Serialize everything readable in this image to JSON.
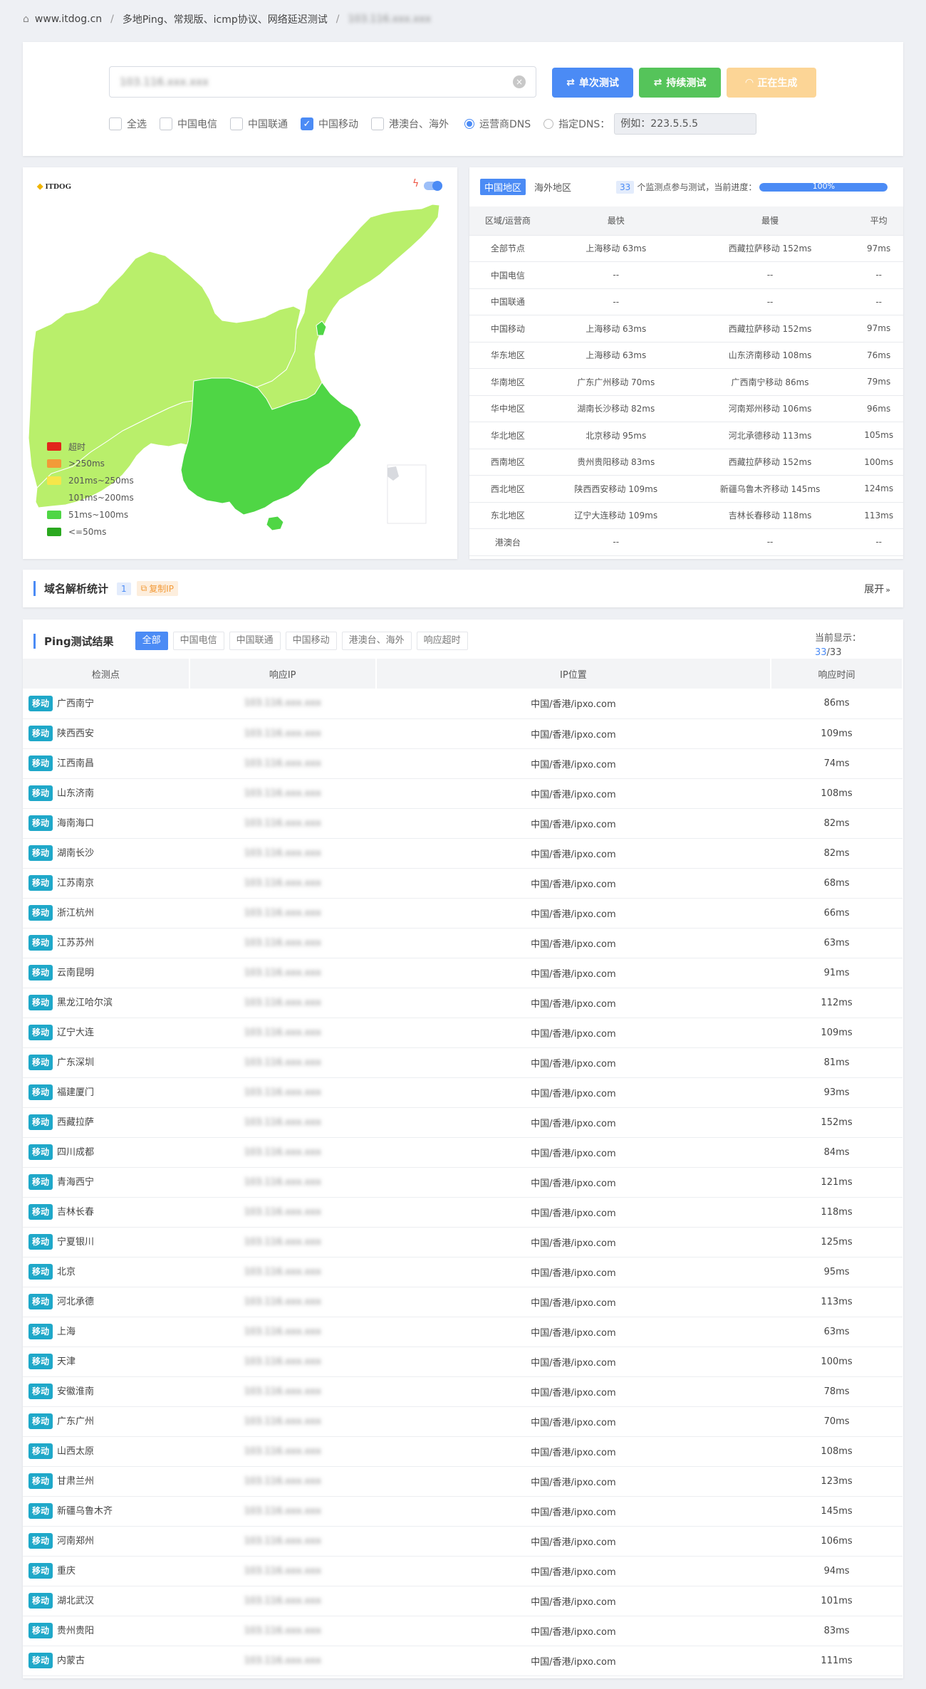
{
  "breadcrumb": {
    "home": "www.itdog.cn",
    "section": "多地Ping、常规版、icmp协议、网络延迟测试",
    "current": "103.116.xxx.xxx"
  },
  "search": {
    "value": "103.116.xxx.xxx",
    "clear": "×"
  },
  "buttons": {
    "single": "单次测试",
    "continuous": "持续测试",
    "generating": "正在生成"
  },
  "isp_options": [
    {
      "label": "全选",
      "checked": false
    },
    {
      "label": "中国电信",
      "checked": false
    },
    {
      "label": "中国联通",
      "checked": false
    },
    {
      "label": "中国移动",
      "checked": true
    },
    {
      "label": "港澳台、海外",
      "checked": false
    }
  ],
  "dns": {
    "operator": "运营商DNS",
    "custom": "指定DNS：",
    "placeholder": "例如：223.5.5.5"
  },
  "map": {
    "logo": "ITDOG",
    "legend": [
      {
        "label": "超时",
        "color": "#e1251b"
      },
      {
        "label": ">250ms",
        "color": "#f29a38"
      },
      {
        "label": "201ms~250ms",
        "color": "#f5e64a"
      },
      {
        "label": "101ms~200ms",
        "color": "#b9ef6b"
      },
      {
        "label": "51ms~100ms",
        "color": "#4fd645"
      },
      {
        "label": "<=50ms",
        "color": "#2aa81f"
      }
    ]
  },
  "stats": {
    "tab_cn": "中国地区",
    "tab_overseas": "海外地区",
    "count": "33",
    "count_text": "个监测点参与测试，当前进度：",
    "progress": 100,
    "progress_label": "100%",
    "headers": [
      "区域/运营商",
      "最快",
      "最慢",
      "平均"
    ],
    "rows": [
      [
        "全部节点",
        "上海移动 63ms",
        "西藏拉萨移动 152ms",
        "97ms"
      ],
      [
        "中国电信",
        "--",
        "--",
        "--"
      ],
      [
        "中国联通",
        "--",
        "--",
        "--"
      ],
      [
        "中国移动",
        "上海移动 63ms",
        "西藏拉萨移动 152ms",
        "97ms"
      ],
      [
        "华东地区",
        "上海移动 63ms",
        "山东济南移动 108ms",
        "76ms"
      ],
      [
        "华南地区",
        "广东广州移动 70ms",
        "广西南宁移动 86ms",
        "79ms"
      ],
      [
        "华中地区",
        "湖南长沙移动 82ms",
        "河南郑州移动 106ms",
        "96ms"
      ],
      [
        "华北地区",
        "北京移动 95ms",
        "河北承德移动 113ms",
        "105ms"
      ],
      [
        "西南地区",
        "贵州贵阳移动 83ms",
        "西藏拉萨移动 152ms",
        "100ms"
      ],
      [
        "西北地区",
        "陕西西安移动 109ms",
        "新疆乌鲁木齐移动 145ms",
        "124ms"
      ],
      [
        "东北地区",
        "辽宁大连移动 109ms",
        "吉林长春移动 118ms",
        "113ms"
      ],
      [
        "港澳台",
        "--",
        "--",
        "--"
      ]
    ]
  },
  "dns_stats": {
    "title": "域名解析统计",
    "count": "1",
    "copy": "复制IP",
    "expand": "展开"
  },
  "results": {
    "title": "Ping测试结果",
    "filters": [
      "全部",
      "中国电信",
      "中国联通",
      "中国移动",
      "港澳台、海外",
      "响应超时"
    ],
    "showing_label": "当前显示：",
    "showing": "33",
    "total": "/33",
    "headers": [
      "检测点",
      "响应IP",
      "IP位置",
      "响应时间"
    ],
    "tag": "移动",
    "ip": "103.116.xxx.xxx",
    "location": "中国/香港/ipxo.com",
    "rows": [
      [
        "广西南宁",
        "86ms"
      ],
      [
        "陕西西安",
        "109ms"
      ],
      [
        "江西南昌",
        "74ms"
      ],
      [
        "山东济南",
        "108ms"
      ],
      [
        "海南海口",
        "82ms"
      ],
      [
        "湖南长沙",
        "82ms"
      ],
      [
        "江苏南京",
        "68ms"
      ],
      [
        "浙江杭州",
        "66ms"
      ],
      [
        "江苏苏州",
        "63ms"
      ],
      [
        "云南昆明",
        "91ms"
      ],
      [
        "黑龙江哈尔滨",
        "112ms"
      ],
      [
        "辽宁大连",
        "109ms"
      ],
      [
        "广东深圳",
        "81ms"
      ],
      [
        "福建厦门",
        "93ms"
      ],
      [
        "西藏拉萨",
        "152ms"
      ],
      [
        "四川成都",
        "84ms"
      ],
      [
        "青海西宁",
        "121ms"
      ],
      [
        "吉林长春",
        "118ms"
      ],
      [
        "宁夏银川",
        "125ms"
      ],
      [
        "北京",
        "95ms"
      ],
      [
        "河北承德",
        "113ms"
      ],
      [
        "上海",
        "63ms"
      ],
      [
        "天津",
        "100ms"
      ],
      [
        "安徽淮南",
        "78ms"
      ],
      [
        "广东广州",
        "70ms"
      ],
      [
        "山西太原",
        "108ms"
      ],
      [
        "甘肃兰州",
        "123ms"
      ],
      [
        "新疆乌鲁木齐",
        "145ms"
      ],
      [
        "河南郑州",
        "106ms"
      ],
      [
        "重庆",
        "94ms"
      ],
      [
        "湖北武汉",
        "101ms"
      ],
      [
        "贵州贵阳",
        "83ms"
      ],
      [
        "内蒙古",
        "111ms"
      ]
    ]
  }
}
